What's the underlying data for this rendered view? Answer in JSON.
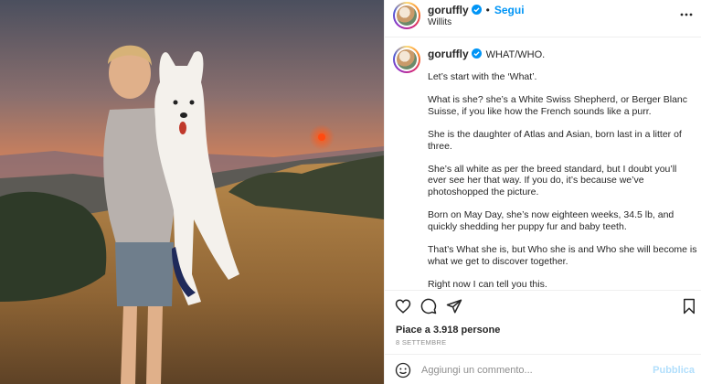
{
  "post": {
    "username": "goruffly",
    "follow_label": "Segui",
    "dot": "•",
    "location": "Willits"
  },
  "caption": {
    "username": "goruffly",
    "title": "WHAT/WHO.",
    "paragraphs": [
      "Let’s start with the ‘What’.",
      "What is she? she’s a White Swiss Shepherd, or Berger Blanc Suisse, if you like how the French sounds like a purr.",
      "She is the daughter of Atlas and Asian, born last in a litter of three.",
      "She’s all white as per the breed standard, but I doubt you’ll ever see her that way. If you do, it’s because we’ve photoshopped the picture.",
      "Born on May Day, she’s now eighteen weeks, 34.5 lb, and quickly shedding her puppy fur and baby teeth.",
      "That’s What she is, but Who she is and Who she will become is what we get to discover together.",
      "Right now I can tell you this."
    ]
  },
  "actions": {
    "likes": "Piace a 3.918 persone",
    "date": "8 SETTEMBRE"
  },
  "comment": {
    "placeholder": "Aggiungi un commento...",
    "publish_label": "Pubblica"
  },
  "icons": {
    "verified": "verified-badge-icon",
    "more": "more-options-icon",
    "like": "heart-icon",
    "comment": "comment-icon",
    "share": "share-icon",
    "save": "bookmark-icon",
    "emoji": "emoji-icon"
  },
  "colors": {
    "link_blue": "#0095f6",
    "publish_disabled": "#b2dffc",
    "sunset_sky": "#f08a4a"
  }
}
